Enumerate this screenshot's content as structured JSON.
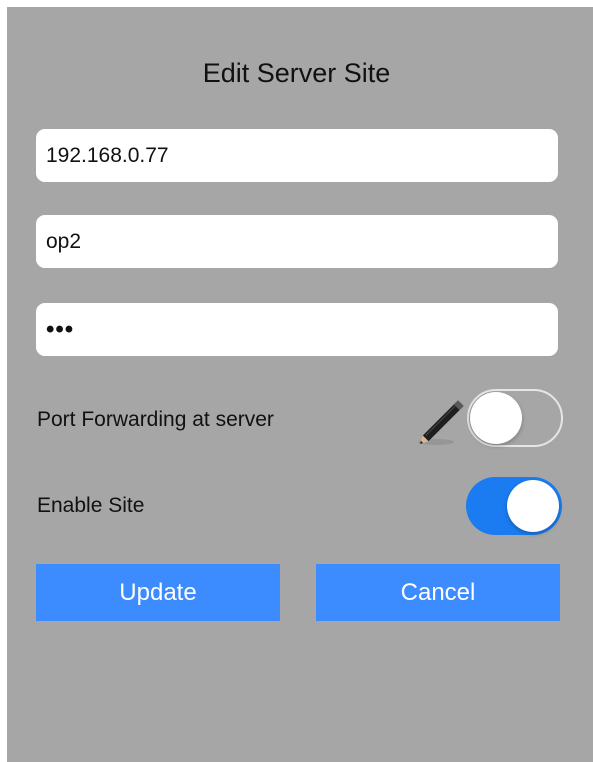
{
  "dialog": {
    "title": "Edit Server Site"
  },
  "fields": {
    "host": {
      "value": "192.168.0.77"
    },
    "username": {
      "value": "op2"
    },
    "password": {
      "value": "•••"
    }
  },
  "options": {
    "port_forwarding": {
      "label": "Port Forwarding at server",
      "enabled": false,
      "icon": "pencil-icon"
    },
    "enable_site": {
      "label": "Enable Site",
      "enabled": true
    }
  },
  "buttons": {
    "update_label": "Update",
    "cancel_label": "Cancel"
  },
  "colors": {
    "panel_bg": "#a6a6a6",
    "accent": "#3c8bff",
    "toggle_on": "#1a7cf0"
  }
}
